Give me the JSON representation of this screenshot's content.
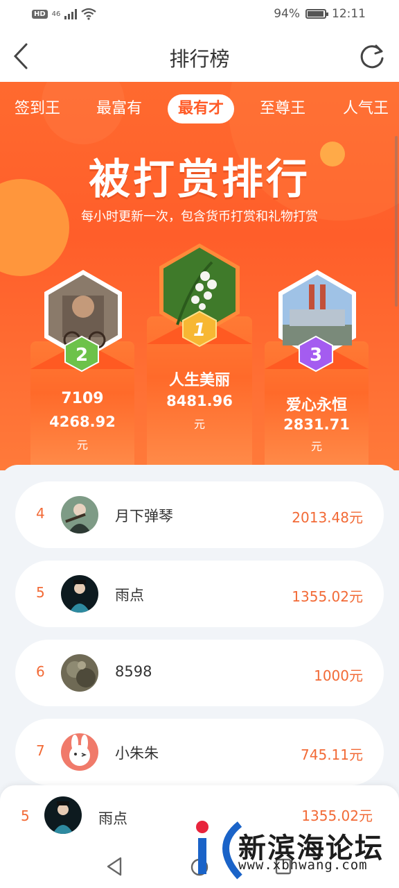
{
  "status_bar": {
    "hd": "HD",
    "signal": "46",
    "battery": "94%",
    "battery_level": 0.94,
    "time": "12:11"
  },
  "header": {
    "title": "排行榜",
    "back_icon": "chevron-left-icon",
    "refresh_icon": "refresh-icon"
  },
  "tabs": [
    "签到王",
    "最富有",
    "最有才",
    "至尊王",
    "人气王"
  ],
  "active_tab": 2,
  "hero": {
    "title": "被打赏排行",
    "subtitle": "每小时更新一次，包含货币打赏和礼物打赏"
  },
  "podium": [
    {
      "rank": "1",
      "name": "人生美丽",
      "amount": "8481.96",
      "unit": "元"
    },
    {
      "rank": "2",
      "name": "7109",
      "amount": "4268.92",
      "unit": "元"
    },
    {
      "rank": "3",
      "name": "爱心永恒",
      "amount": "2831.71",
      "unit": "元"
    }
  ],
  "list": [
    {
      "rank": "4",
      "name": "月下弹琴",
      "amount": "2013.48元"
    },
    {
      "rank": "5",
      "name": "雨点",
      "amount": "1355.02元"
    },
    {
      "rank": "6",
      "name": "8598",
      "amount": "1000元"
    },
    {
      "rank": "7",
      "name": "小朱朱",
      "amount": "745.11元"
    }
  ],
  "me": {
    "rank": "5",
    "name": "雨点",
    "amount": "1355.02元"
  },
  "watermark": {
    "text": "新滨海论坛",
    "url": "www.xbhwang.com"
  },
  "colors": {
    "accent": "#ff5a26",
    "amount": "#f26a36",
    "gold": "#f7b733",
    "silver": "#6dc24a",
    "bronze": "#a45cf0"
  }
}
